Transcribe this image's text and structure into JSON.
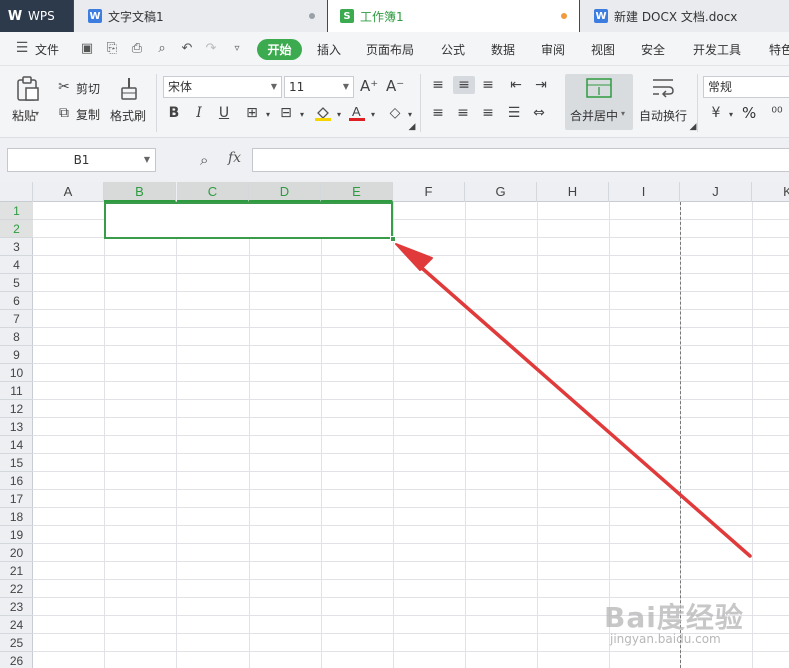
{
  "tabs": {
    "wps": "WPS",
    "doc1": "文字文稿1",
    "sheet": "工作簿1",
    "docx": "新建 DOCX 文档.docx"
  },
  "menu": {
    "file": "文件",
    "items": [
      "开始",
      "插入",
      "页面布局",
      "公式",
      "数据",
      "审阅",
      "视图",
      "安全",
      "开发工具",
      "特色"
    ]
  },
  "ribbon": {
    "paste": "粘贴",
    "cut": "剪切",
    "copy": "复制",
    "format_painter": "格式刷",
    "font_name": "宋体",
    "font_size": "11",
    "merge_center": "合并居中",
    "wrap_text": "自动换行",
    "number_format": "常规",
    "percent": "%"
  },
  "formula_bar": {
    "name_box": "B1",
    "fx": "fx",
    "value": ""
  },
  "sheet": {
    "columns": [
      "A",
      "B",
      "C",
      "D",
      "E",
      "F",
      "G",
      "H",
      "I",
      "J",
      "K"
    ],
    "selected_columns": [
      "B",
      "C",
      "D",
      "E"
    ],
    "rows": [
      "1",
      "2",
      "3",
      "4",
      "5",
      "6",
      "7",
      "8",
      "9",
      "10",
      "11",
      "12",
      "13",
      "14",
      "15",
      "16",
      "17",
      "18",
      "19",
      "20",
      "21",
      "22",
      "23",
      "24",
      "25",
      "26"
    ],
    "selected_rows": [
      "1",
      "2"
    ],
    "selection_range": "B1:E2"
  },
  "colors": {
    "accent_green": "#2e9b41",
    "arrow_red": "#e03a3a"
  },
  "watermark": {
    "brand": "Bai度经验",
    "url": "jingyan.baidu.com"
  }
}
